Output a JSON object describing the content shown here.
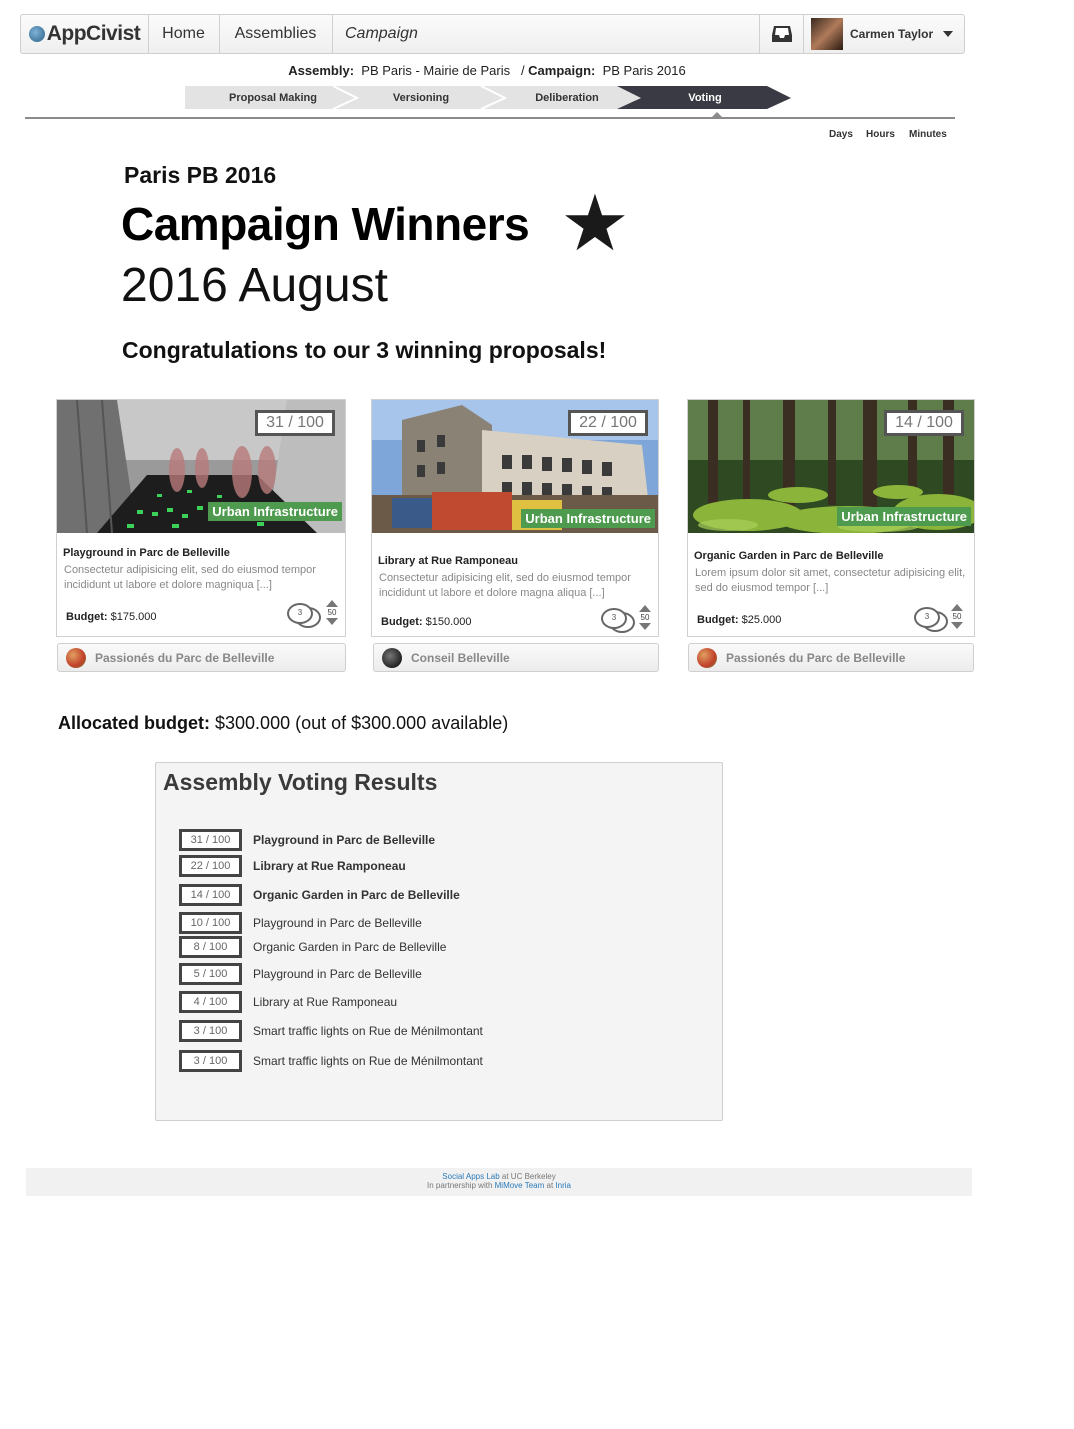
{
  "nav": {
    "logo": "AppCivist",
    "home": "Home",
    "assemblies": "Assemblies",
    "campaign": "Campaign",
    "user_name": "Carmen Taylor"
  },
  "breadcrumb": {
    "assembly_label": "Assembly:",
    "assembly_value": "PB Paris - Mairie de Paris",
    "campaign_label": "Campaign:",
    "campaign_value": "PB Paris 2016"
  },
  "phases": [
    "Proposal Making",
    "Versioning",
    "Deliberation",
    "Voting"
  ],
  "active_phase": "Voting",
  "time_units": [
    "Days",
    "Hours",
    "Minutes"
  ],
  "header": {
    "campaign_name": "Paris PB 2016",
    "title": "Campaign Winners",
    "date": "2016 August",
    "congrats": "Congratulations to our 3 winning proposals!"
  },
  "cards": [
    {
      "score": "31 / 100",
      "tag": "Urban Infrastructure",
      "title": "Playground in Parc de Belleville",
      "description": "Consectetur adipisicing elit, sed do eiusmod tempor incididunt ut labore et dolore magniqua [...]",
      "budget_label": "Budget:",
      "budget": "$175.000",
      "comments": "3",
      "votes": "50",
      "group": "Passionés du Parc de Belleville"
    },
    {
      "score": "22 / 100",
      "tag": "Urban Infrastructure",
      "title": "Library at Rue Ramponeau",
      "description": "Consectetur adipisicing elit, sed do eiusmod tempor incididunt ut labore et dolore magna aliqua [...]",
      "budget_label": "Budget:",
      "budget": "$150.000",
      "comments": "3",
      "votes": "50",
      "group": "Conseil Belleville"
    },
    {
      "score": "14 / 100",
      "tag": "Urban Infrastructure",
      "title": "Organic Garden in Parc de Belleville",
      "description": "Lorem ipsum dolor sit amet, consectetur adipisicing elit, sed do eiusmod tempor [...]",
      "budget_label": "Budget:",
      "budget": "$25.000",
      "comments": "3",
      "votes": "50",
      "group": "Passionés du Parc de Belleville"
    }
  ],
  "allocated": {
    "label": "Allocated budget:",
    "value": "$300.000 (out of $300.000 available)"
  },
  "results": {
    "title": "Assembly Voting Results",
    "rows": [
      {
        "score": "31 / 100",
        "name": "Playground in Parc de Belleville"
      },
      {
        "score": "22 / 100",
        "name": "Library at Rue Ramponeau"
      },
      {
        "score": "14 / 100",
        "name": "Organic Garden in Parc de Belleville"
      },
      {
        "score": "10 / 100",
        "name": "Playground in Parc de Belleville"
      },
      {
        "score": "8 / 100",
        "name": "Organic Garden in Parc de Belleville"
      },
      {
        "score": "5 / 100",
        "name": "Playground in Parc de Belleville"
      },
      {
        "score": "4 / 100",
        "name": "Library at Rue Ramponeau"
      },
      {
        "score": "3 / 100",
        "name": "Smart traffic lights on Rue de Ménilmontant"
      },
      {
        "score": "3 / 100",
        "name": "Smart traffic lights on Rue de Ménilmontant"
      }
    ]
  },
  "footer": {
    "line1_link": "Social Apps Lab",
    "line1_rest": " at UC Berkeley",
    "line2_pre": "In partnership with ",
    "line2_link1": "MiMove Team",
    "line2_mid": " at ",
    "line2_link2": "Inria"
  },
  "colors": {
    "tag_green": "#4e9a4e",
    "phase_active": "#3a3a44",
    "phase_inactive": "#e3e3e3",
    "link_blue": "#2a7ab8"
  }
}
